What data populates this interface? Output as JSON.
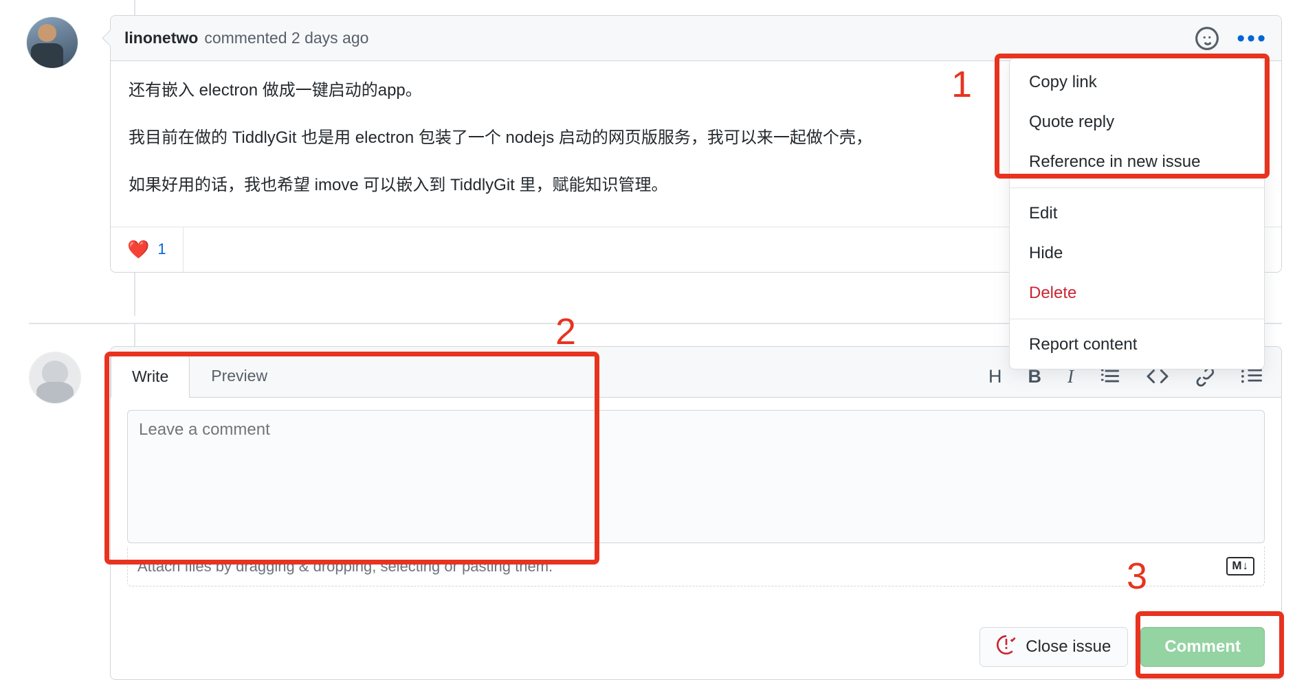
{
  "comment": {
    "author": "linonetwo",
    "meta": "commented 2 days ago",
    "paragraphs": [
      "还有嵌入 electron 做成一键启动的app。",
      "我目前在做的 TiddlyGit 也是用 electron 包装了一个 nodejs 启动的网页版服务，我可以来一起做个壳，",
      "如果好用的话，我也希望 imove 可以嵌入到 TiddlyGit 里，赋能知识管理。"
    ],
    "reaction": {
      "emoji": "❤️",
      "count": "1"
    }
  },
  "menu": {
    "group1": [
      "Copy link",
      "Quote reply",
      "Reference in new issue"
    ],
    "group2": [
      "Edit",
      "Hide",
      "Delete"
    ],
    "group3": [
      "Report content"
    ]
  },
  "form": {
    "tabs": [
      {
        "label": "Write",
        "active": true
      },
      {
        "label": "Preview",
        "active": false
      }
    ],
    "toolbar": [
      {
        "name": "heading-icon",
        "glyph": "H"
      },
      {
        "name": "bold-icon",
        "glyph": "B"
      },
      {
        "name": "italic-icon",
        "glyph": "I"
      },
      {
        "name": "quote-icon",
        "glyph": ""
      },
      {
        "name": "code-icon",
        "glyph": "<>"
      },
      {
        "name": "link-icon",
        "glyph": ""
      },
      {
        "name": "unordered-list-icon",
        "glyph": ""
      }
    ],
    "textarea_placeholder": "Leave a comment",
    "textarea_value": "",
    "dropzone_text": "Attach files by dragging & dropping, selecting or pasting them.",
    "markdown_badge": "M↓",
    "close_issue_label": "Close issue",
    "comment_label": "Comment"
  },
  "annotations": {
    "one": "1",
    "two": "2",
    "three": "3"
  },
  "colors": {
    "accent_blue": "#0366d6",
    "danger_red": "#cb2431",
    "annotation_red": "#e8331f",
    "comment_green": "#94d3a2",
    "border": "#d1d5da",
    "header_bg": "#f6f8fa"
  }
}
